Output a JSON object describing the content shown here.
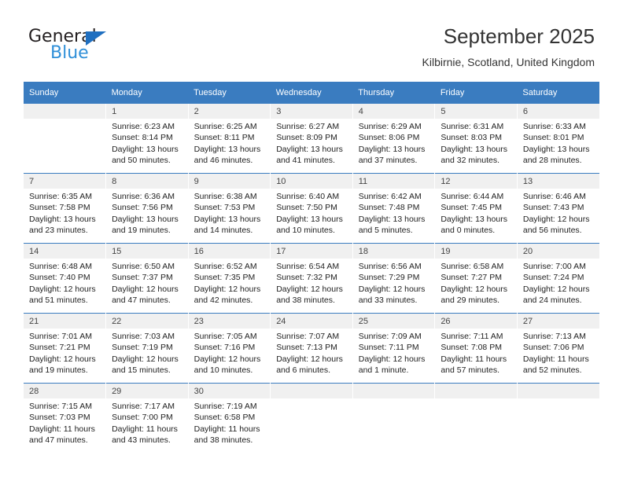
{
  "brand": {
    "name_dark": "General",
    "name_blue": "Blue",
    "accent_blue": "#2f8fd8",
    "triangle_blue": "#1f6fc0"
  },
  "header": {
    "title": "September 2025",
    "subtitle": "Kilbirnie, Scotland, United Kingdom",
    "header_bg": "#3a7cc0",
    "header_text": "#ffffff"
  },
  "weekdays": [
    "Sunday",
    "Monday",
    "Tuesday",
    "Wednesday",
    "Thursday",
    "Friday",
    "Saturday"
  ],
  "labels": {
    "sunrise_prefix": "Sunrise:",
    "sunset_prefix": "Sunset:",
    "daylight_prefix": "Daylight:"
  },
  "weeks": [
    [
      {
        "day": "",
        "sunrise": "",
        "sunset": "",
        "daylight": "",
        "blank": true
      },
      {
        "day": "1",
        "sunrise": "Sunrise: 6:23 AM",
        "sunset": "Sunset: 8:14 PM",
        "daylight": "Daylight: 13 hours and 50 minutes."
      },
      {
        "day": "2",
        "sunrise": "Sunrise: 6:25 AM",
        "sunset": "Sunset: 8:11 PM",
        "daylight": "Daylight: 13 hours and 46 minutes."
      },
      {
        "day": "3",
        "sunrise": "Sunrise: 6:27 AM",
        "sunset": "Sunset: 8:09 PM",
        "daylight": "Daylight: 13 hours and 41 minutes."
      },
      {
        "day": "4",
        "sunrise": "Sunrise: 6:29 AM",
        "sunset": "Sunset: 8:06 PM",
        "daylight": "Daylight: 13 hours and 37 minutes."
      },
      {
        "day": "5",
        "sunrise": "Sunrise: 6:31 AM",
        "sunset": "Sunset: 8:03 PM",
        "daylight": "Daylight: 13 hours and 32 minutes."
      },
      {
        "day": "6",
        "sunrise": "Sunrise: 6:33 AM",
        "sunset": "Sunset: 8:01 PM",
        "daylight": "Daylight: 13 hours and 28 minutes."
      }
    ],
    [
      {
        "day": "7",
        "sunrise": "Sunrise: 6:35 AM",
        "sunset": "Sunset: 7:58 PM",
        "daylight": "Daylight: 13 hours and 23 minutes."
      },
      {
        "day": "8",
        "sunrise": "Sunrise: 6:36 AM",
        "sunset": "Sunset: 7:56 PM",
        "daylight": "Daylight: 13 hours and 19 minutes."
      },
      {
        "day": "9",
        "sunrise": "Sunrise: 6:38 AM",
        "sunset": "Sunset: 7:53 PM",
        "daylight": "Daylight: 13 hours and 14 minutes."
      },
      {
        "day": "10",
        "sunrise": "Sunrise: 6:40 AM",
        "sunset": "Sunset: 7:50 PM",
        "daylight": "Daylight: 13 hours and 10 minutes."
      },
      {
        "day": "11",
        "sunrise": "Sunrise: 6:42 AM",
        "sunset": "Sunset: 7:48 PM",
        "daylight": "Daylight: 13 hours and 5 minutes."
      },
      {
        "day": "12",
        "sunrise": "Sunrise: 6:44 AM",
        "sunset": "Sunset: 7:45 PM",
        "daylight": "Daylight: 13 hours and 0 minutes."
      },
      {
        "day": "13",
        "sunrise": "Sunrise: 6:46 AM",
        "sunset": "Sunset: 7:43 PM",
        "daylight": "Daylight: 12 hours and 56 minutes."
      }
    ],
    [
      {
        "day": "14",
        "sunrise": "Sunrise: 6:48 AM",
        "sunset": "Sunset: 7:40 PM",
        "daylight": "Daylight: 12 hours and 51 minutes."
      },
      {
        "day": "15",
        "sunrise": "Sunrise: 6:50 AM",
        "sunset": "Sunset: 7:37 PM",
        "daylight": "Daylight: 12 hours and 47 minutes."
      },
      {
        "day": "16",
        "sunrise": "Sunrise: 6:52 AM",
        "sunset": "Sunset: 7:35 PM",
        "daylight": "Daylight: 12 hours and 42 minutes."
      },
      {
        "day": "17",
        "sunrise": "Sunrise: 6:54 AM",
        "sunset": "Sunset: 7:32 PM",
        "daylight": "Daylight: 12 hours and 38 minutes."
      },
      {
        "day": "18",
        "sunrise": "Sunrise: 6:56 AM",
        "sunset": "Sunset: 7:29 PM",
        "daylight": "Daylight: 12 hours and 33 minutes."
      },
      {
        "day": "19",
        "sunrise": "Sunrise: 6:58 AM",
        "sunset": "Sunset: 7:27 PM",
        "daylight": "Daylight: 12 hours and 29 minutes."
      },
      {
        "day": "20",
        "sunrise": "Sunrise: 7:00 AM",
        "sunset": "Sunset: 7:24 PM",
        "daylight": "Daylight: 12 hours and 24 minutes."
      }
    ],
    [
      {
        "day": "21",
        "sunrise": "Sunrise: 7:01 AM",
        "sunset": "Sunset: 7:21 PM",
        "daylight": "Daylight: 12 hours and 19 minutes."
      },
      {
        "day": "22",
        "sunrise": "Sunrise: 7:03 AM",
        "sunset": "Sunset: 7:19 PM",
        "daylight": "Daylight: 12 hours and 15 minutes."
      },
      {
        "day": "23",
        "sunrise": "Sunrise: 7:05 AM",
        "sunset": "Sunset: 7:16 PM",
        "daylight": "Daylight: 12 hours and 10 minutes."
      },
      {
        "day": "24",
        "sunrise": "Sunrise: 7:07 AM",
        "sunset": "Sunset: 7:13 PM",
        "daylight": "Daylight: 12 hours and 6 minutes."
      },
      {
        "day": "25",
        "sunrise": "Sunrise: 7:09 AM",
        "sunset": "Sunset: 7:11 PM",
        "daylight": "Daylight: 12 hours and 1 minute."
      },
      {
        "day": "26",
        "sunrise": "Sunrise: 7:11 AM",
        "sunset": "Sunset: 7:08 PM",
        "daylight": "Daylight: 11 hours and 57 minutes."
      },
      {
        "day": "27",
        "sunrise": "Sunrise: 7:13 AM",
        "sunset": "Sunset: 7:06 PM",
        "daylight": "Daylight: 11 hours and 52 minutes."
      }
    ],
    [
      {
        "day": "28",
        "sunrise": "Sunrise: 7:15 AM",
        "sunset": "Sunset: 7:03 PM",
        "daylight": "Daylight: 11 hours and 47 minutes."
      },
      {
        "day": "29",
        "sunrise": "Sunrise: 7:17 AM",
        "sunset": "Sunset: 7:00 PM",
        "daylight": "Daylight: 11 hours and 43 minutes."
      },
      {
        "day": "30",
        "sunrise": "Sunrise: 7:19 AM",
        "sunset": "Sunset: 6:58 PM",
        "daylight": "Daylight: 11 hours and 38 minutes."
      },
      {
        "day": "",
        "sunrise": "",
        "sunset": "",
        "daylight": "",
        "blank": true
      },
      {
        "day": "",
        "sunrise": "",
        "sunset": "",
        "daylight": "",
        "blank": true
      },
      {
        "day": "",
        "sunrise": "",
        "sunset": "",
        "daylight": "",
        "blank": true
      },
      {
        "day": "",
        "sunrise": "",
        "sunset": "",
        "daylight": "",
        "blank": true
      }
    ]
  ]
}
